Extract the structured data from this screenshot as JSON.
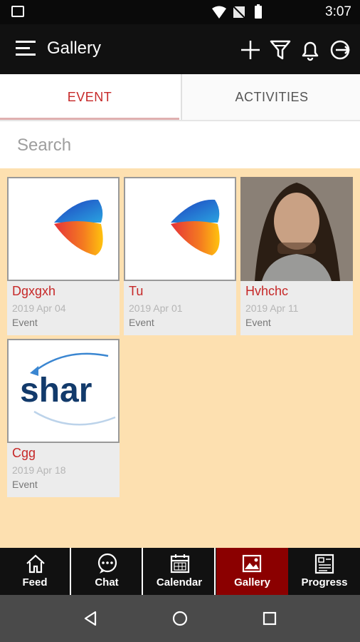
{
  "status_bar": {
    "time": "3:07"
  },
  "app_bar": {
    "title": "Gallery",
    "actions": [
      "add-icon",
      "filter-icon",
      "bell-icon",
      "logout-icon"
    ]
  },
  "tabs": [
    {
      "label": "EVENT",
      "active": true
    },
    {
      "label": "ACTIVITIES",
      "active": false
    }
  ],
  "search": {
    "placeholder": "Search"
  },
  "cards": [
    {
      "name": "Dgxgxh",
      "date": "2019 Apr 04",
      "kind": "Event",
      "thumb": "brand-logo"
    },
    {
      "name": "Tu",
      "date": "2019 Apr 01",
      "kind": "Event",
      "thumb": "brand-logo"
    },
    {
      "name": "Hvhchc",
      "date": "2019 Apr 11",
      "kind": "Event",
      "thumb": "portrait-photo"
    },
    {
      "name": "Cgg",
      "date": "2019 Apr 18",
      "kind": "Event",
      "thumb": "share-logo",
      "thumb_text": "shar"
    }
  ],
  "bottom_nav": [
    {
      "label": "Feed",
      "icon": "home-icon",
      "active": false
    },
    {
      "label": "Chat",
      "icon": "chat-icon",
      "active": false
    },
    {
      "label": "Calendar",
      "icon": "calendar-icon",
      "active": false
    },
    {
      "label": "Gallery",
      "icon": "gallery-icon",
      "active": true
    },
    {
      "label": "Progress",
      "icon": "progress-icon",
      "active": false
    }
  ],
  "colors": {
    "accent": "#c62828",
    "content_bg": "#fde0b0",
    "active_nav": "#8b0000"
  }
}
